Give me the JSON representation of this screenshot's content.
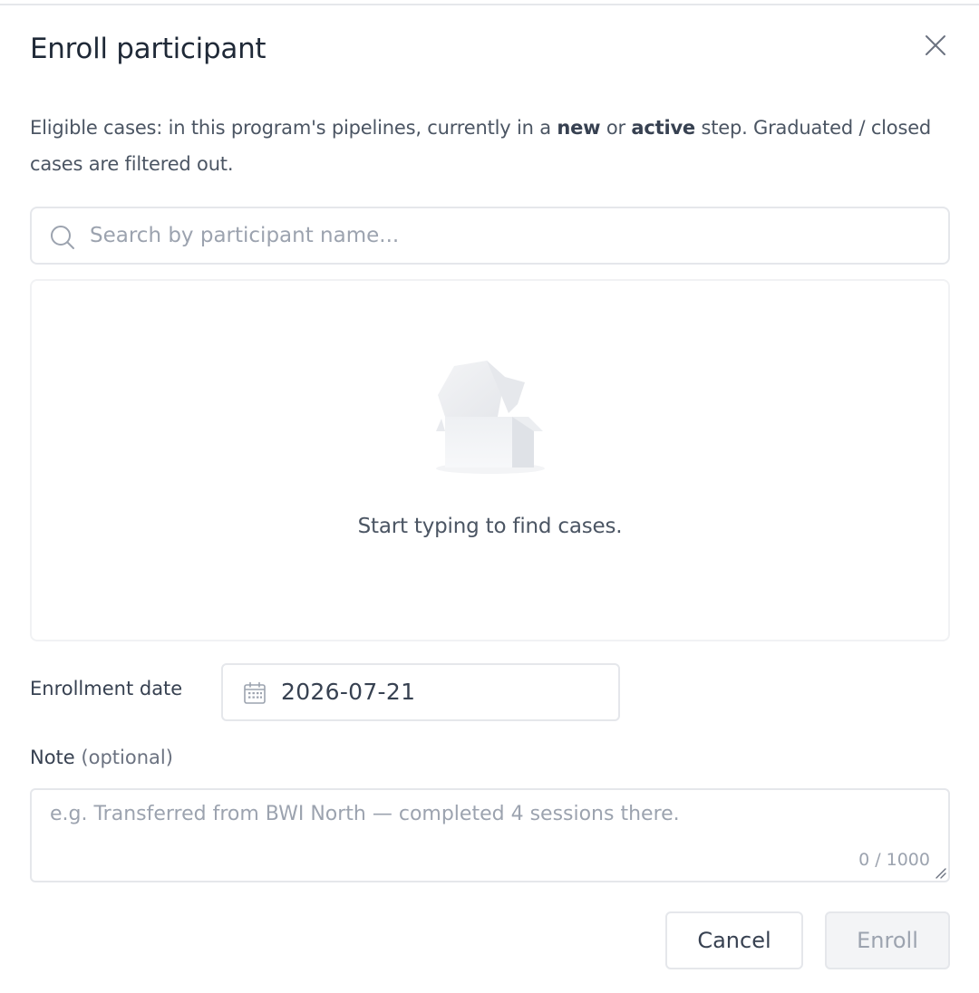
{
  "dialog": {
    "title": "Enroll participant",
    "description": {
      "part1": "Eligible cases: in this program's pipelines, currently in a ",
      "bold1": "new",
      "part2": " or ",
      "bold2": "active",
      "part3": " step. Graduated / closed cases are filtered out."
    },
    "search": {
      "placeholder": "Search by participant name...",
      "value": ""
    },
    "results": {
      "empty_text": "Start typing to find cases."
    },
    "enrollment_date": {
      "label": "Enrollment date",
      "value": "2026-07-21"
    },
    "note": {
      "label": "Note",
      "label_suffix": "(optional)",
      "placeholder": "e.g. Transferred from BWI North — completed 4 sessions there.",
      "value": "",
      "counter": "0 / 1000"
    },
    "buttons": {
      "cancel_label": "Cancel",
      "enroll_label": "Enroll"
    }
  },
  "icons": {
    "close": "close-icon",
    "search": "search-icon",
    "calendar": "calendar-icon",
    "empty": "empty-box-illustration",
    "resize": "resize-grip-icon"
  },
  "colors": {
    "title": "#1f2937",
    "text": "#4b5563",
    "border": "#e5e7eb",
    "placeholder": "#9ca3af",
    "disabled_bg": "#f3f4f6"
  }
}
